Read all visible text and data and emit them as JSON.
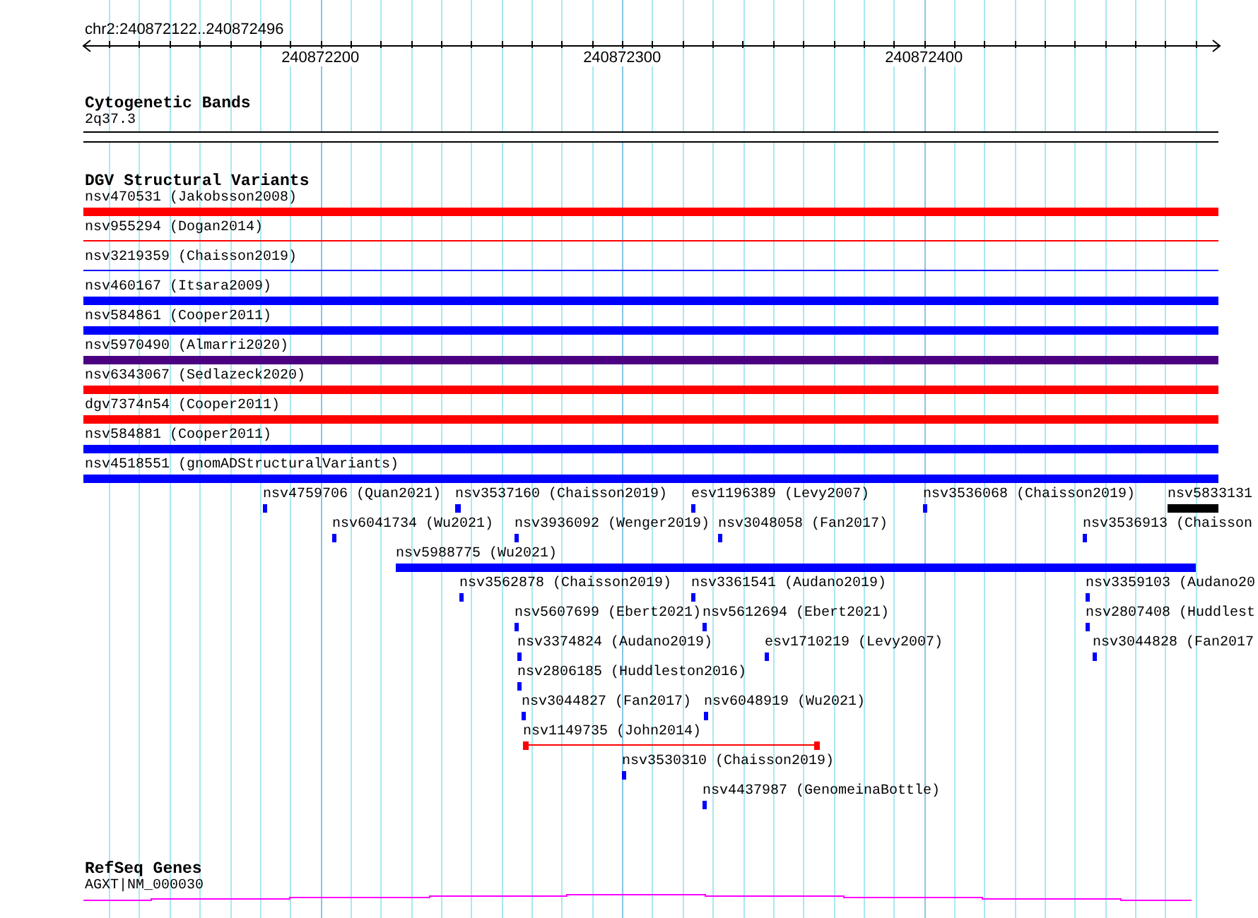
{
  "ruler": {
    "region": "chr2:240872122..240872496",
    "tick_labels": [
      "240872200",
      "240872300",
      "240872400"
    ]
  },
  "tracks": [
    {
      "kind": "cytobands",
      "title": "Cytogenetic Bands",
      "label": "2q37.3"
    },
    {
      "kind": "variants",
      "title": "DGV Structural Variants",
      "rows": [
        [
          {
            "label": "nsv470531 (Jakobsson2008)",
            "kind": "block",
            "color": "#ff0000"
          }
        ],
        [
          {
            "label": "nsv955294 (Dogan2014)",
            "kind": "line",
            "color": "#ff0000"
          }
        ],
        [
          {
            "label": "nsv3219359 (Chaisson2019)",
            "kind": "line",
            "color": "#0000ff"
          }
        ],
        [
          {
            "label": "nsv460167 (Itsara2009)",
            "kind": "block",
            "color": "#0000ff"
          }
        ],
        [
          {
            "label": "nsv584861 (Cooper2011)",
            "kind": "block",
            "color": "#0000ff"
          }
        ],
        [
          {
            "label": "nsv5970490 (Almarri2020)",
            "kind": "block",
            "color": "#4b0082"
          }
        ],
        [
          {
            "label": "nsv6343067 (Sedlazeck2020)",
            "kind": "block",
            "color": "#ff0000"
          }
        ],
        [
          {
            "label": "dgv7374n54 (Cooper2011)",
            "kind": "block",
            "color": "#ff0000"
          }
        ],
        [
          {
            "label": "nsv584881 (Cooper2011)",
            "kind": "block",
            "color": "#0000ff"
          }
        ],
        [
          {
            "label": "nsv4518551 (gnomADStructuralVariants)",
            "kind": "block",
            "color": "#0000ff"
          }
        ],
        [
          {
            "label": "nsv4759706 (Quan2021)",
            "kind": "block",
            "color": "#0000ff"
          },
          {
            "label": "nsv3537160 (Chaisson2019)",
            "kind": "block",
            "color": "#0000ff"
          },
          {
            "label": "esv1196389 (Levy2007)",
            "kind": "block",
            "color": "#0000ff"
          },
          {
            "label": "nsv3536068 (Chaisson2019)",
            "kind": "block",
            "color": "#0000ff"
          },
          {
            "label": "nsv5833131",
            "kind": "block",
            "color": "#000000"
          }
        ],
        [
          {
            "label": "nsv6041734 (Wu2021)",
            "kind": "block",
            "color": "#0000ff"
          },
          {
            "label": "nsv3936092 (Wenger2019)",
            "kind": "block",
            "color": "#0000ff"
          },
          {
            "label": "nsv3048058 (Fan2017)",
            "kind": "block",
            "color": "#0000ff"
          },
          {
            "label": "nsv3536913 (Chaisson",
            "kind": "block",
            "color": "#0000ff"
          }
        ],
        [
          {
            "label": "nsv5988775 (Wu2021)",
            "kind": "block",
            "color": "#0000ff"
          }
        ],
        [
          {
            "label": "nsv3562878 (Chaisson2019)",
            "kind": "block",
            "color": "#0000ff"
          },
          {
            "label": "nsv3361541 (Audano2019)",
            "kind": "block",
            "color": "#0000ff"
          },
          {
            "label": "nsv3359103 (Audano20",
            "kind": "block",
            "color": "#0000ff"
          }
        ],
        [
          {
            "label": "nsv5607699 (Ebert2021)",
            "kind": "block",
            "color": "#0000ff"
          },
          {
            "label": "nsv5612694 (Ebert2021)",
            "kind": "block",
            "color": "#0000ff"
          },
          {
            "label": "nsv2807408 (Huddlest",
            "kind": "block",
            "color": "#0000ff"
          }
        ],
        [
          {
            "label": "nsv3374824 (Audano2019)",
            "kind": "block",
            "color": "#0000ff"
          },
          {
            "label": "esv1710219 (Levy2007)",
            "kind": "block",
            "color": "#0000ff"
          },
          {
            "label": "nsv3044828 (Fan2017",
            "kind": "block",
            "color": "#0000ff"
          }
        ],
        [
          {
            "label": "nsv2806185 (Huddleston2016)",
            "kind": "block",
            "color": "#0000ff"
          }
        ],
        [
          {
            "label": "nsv3044827 (Fan2017)",
            "kind": "block",
            "color": "#0000ff"
          },
          {
            "label": "nsv6048919 (Wu2021)",
            "kind": "block",
            "color": "#0000ff"
          }
        ],
        [
          {
            "label": "nsv1149735 (John2014)",
            "kind": "span",
            "color": "#ff0000"
          }
        ],
        [
          {
            "label": "nsv3530310 (Chaisson2019)",
            "kind": "block",
            "color": "#0000ff"
          }
        ],
        [
          {
            "label": "nsv4437987 (GenomeinaBottle)",
            "kind": "block",
            "color": "#0000ff"
          }
        ]
      ]
    },
    {
      "kind": "genes",
      "title": "RefSeq Genes",
      "label": "AGXT|NM_000030"
    }
  ]
}
